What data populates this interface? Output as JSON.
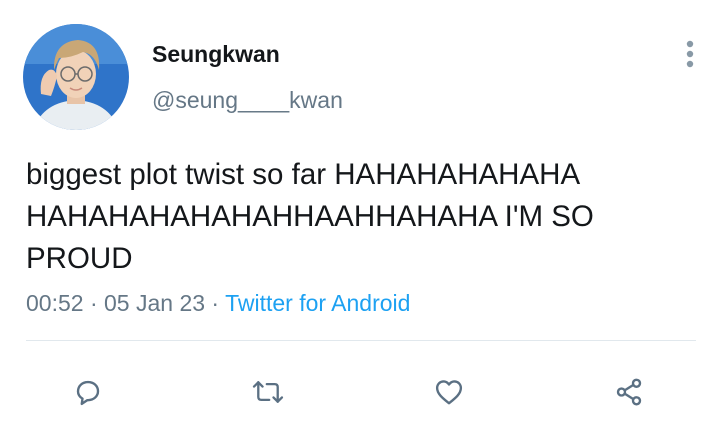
{
  "user": {
    "display_name": "Seungkwan",
    "handle": "@seung____kwan",
    "avatar_icon": "profile-photo"
  },
  "tweet": {
    "lines": [
      "biggest plot twist so far HAHAHAHAHAHA",
      "HAHAHAHAHAHAHHAAHHAHAHA I'M SO",
      "PROUD"
    ],
    "time": "00:52",
    "separator": " · ",
    "date": "05 Jan 23",
    "source": "Twitter for Android"
  },
  "actions": [
    {
      "name": "reply",
      "icon": "reply-icon"
    },
    {
      "name": "retweet",
      "icon": "retweet-icon"
    },
    {
      "name": "like",
      "icon": "heart-icon"
    },
    {
      "name": "share",
      "icon": "share-icon"
    }
  ],
  "colors": {
    "text": "#14171a",
    "secondary": "#657786",
    "link": "#1da1f2",
    "icon": "#5b7083",
    "divider": "#e1e8ed"
  }
}
